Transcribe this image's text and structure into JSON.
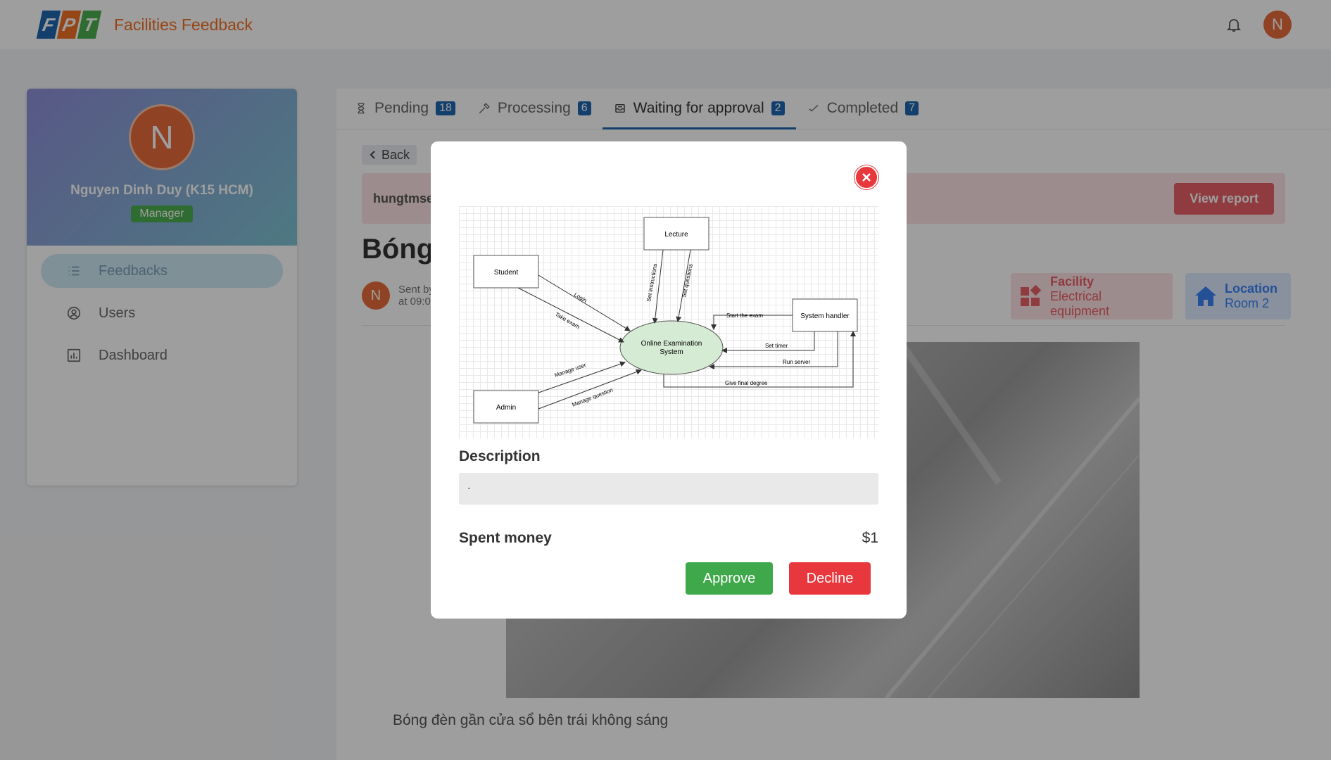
{
  "header": {
    "logo_letters": [
      "F",
      "P",
      "T"
    ],
    "app_title": "Facilities Feedback",
    "avatar_initial": "N"
  },
  "sidebar": {
    "avatar_initial": "N",
    "user_name": "Nguyen Dinh Duy (K15 HCM)",
    "role": "Manager",
    "items": [
      {
        "label": "Feedbacks",
        "icon": "list-icon",
        "active": true
      },
      {
        "label": "Users",
        "icon": "user-circle-icon",
        "active": false
      },
      {
        "label": "Dashboard",
        "icon": "bar-chart-icon",
        "active": false
      }
    ]
  },
  "tabs": [
    {
      "label": "Pending",
      "count": "18",
      "icon": "hourglass-icon"
    },
    {
      "label": "Processing",
      "count": "6",
      "icon": "hammer-icon"
    },
    {
      "label": "Waiting for approval",
      "count": "2",
      "icon": "inbox-icon",
      "active": true
    },
    {
      "label": "Completed",
      "count": "7",
      "icon": "check-icon"
    }
  ],
  "detail": {
    "back_label": "Back",
    "alert_user": "hungtmse",
    "view_report_label": "View report",
    "title": "Bóng",
    "sender_initial": "N",
    "sent_line1": "Sent by",
    "sent_line2": "at 09:0",
    "facility_label": "Facility",
    "facility_value": "Electrical equipment",
    "location_label": "Location",
    "location_value": "Room 2",
    "photo_caption": "Bóng đèn gần cửa sổ bên trái không sáng"
  },
  "modal": {
    "diagram": {
      "nodes": {
        "lecture": "Lecture",
        "student": "Student",
        "system_handler": "System handler",
        "admin": "Admin",
        "center_line1": "Online Examination",
        "center_line2": "System"
      },
      "edges": {
        "login": "Login",
        "take_exam": "Take exam",
        "set_instructions": "Set instructions",
        "set_questions": "Set questions",
        "start_exam": "Start the exam",
        "set_timer": "Set timer",
        "run_server": "Run server",
        "give_final_degree": "Give final degree",
        "manage_user": "Manage user",
        "manage_question": "Manage question"
      }
    },
    "description_label": "Description",
    "description_value": ".",
    "spent_money_label": "Spent money",
    "spent_money_value": "$1",
    "approve_label": "Approve",
    "decline_label": "Decline"
  },
  "colors": {
    "brand_orange": "#f27024",
    "brand_blue": "#1f66b1",
    "approve_green": "#3fa84a",
    "decline_red": "#e8383d"
  }
}
